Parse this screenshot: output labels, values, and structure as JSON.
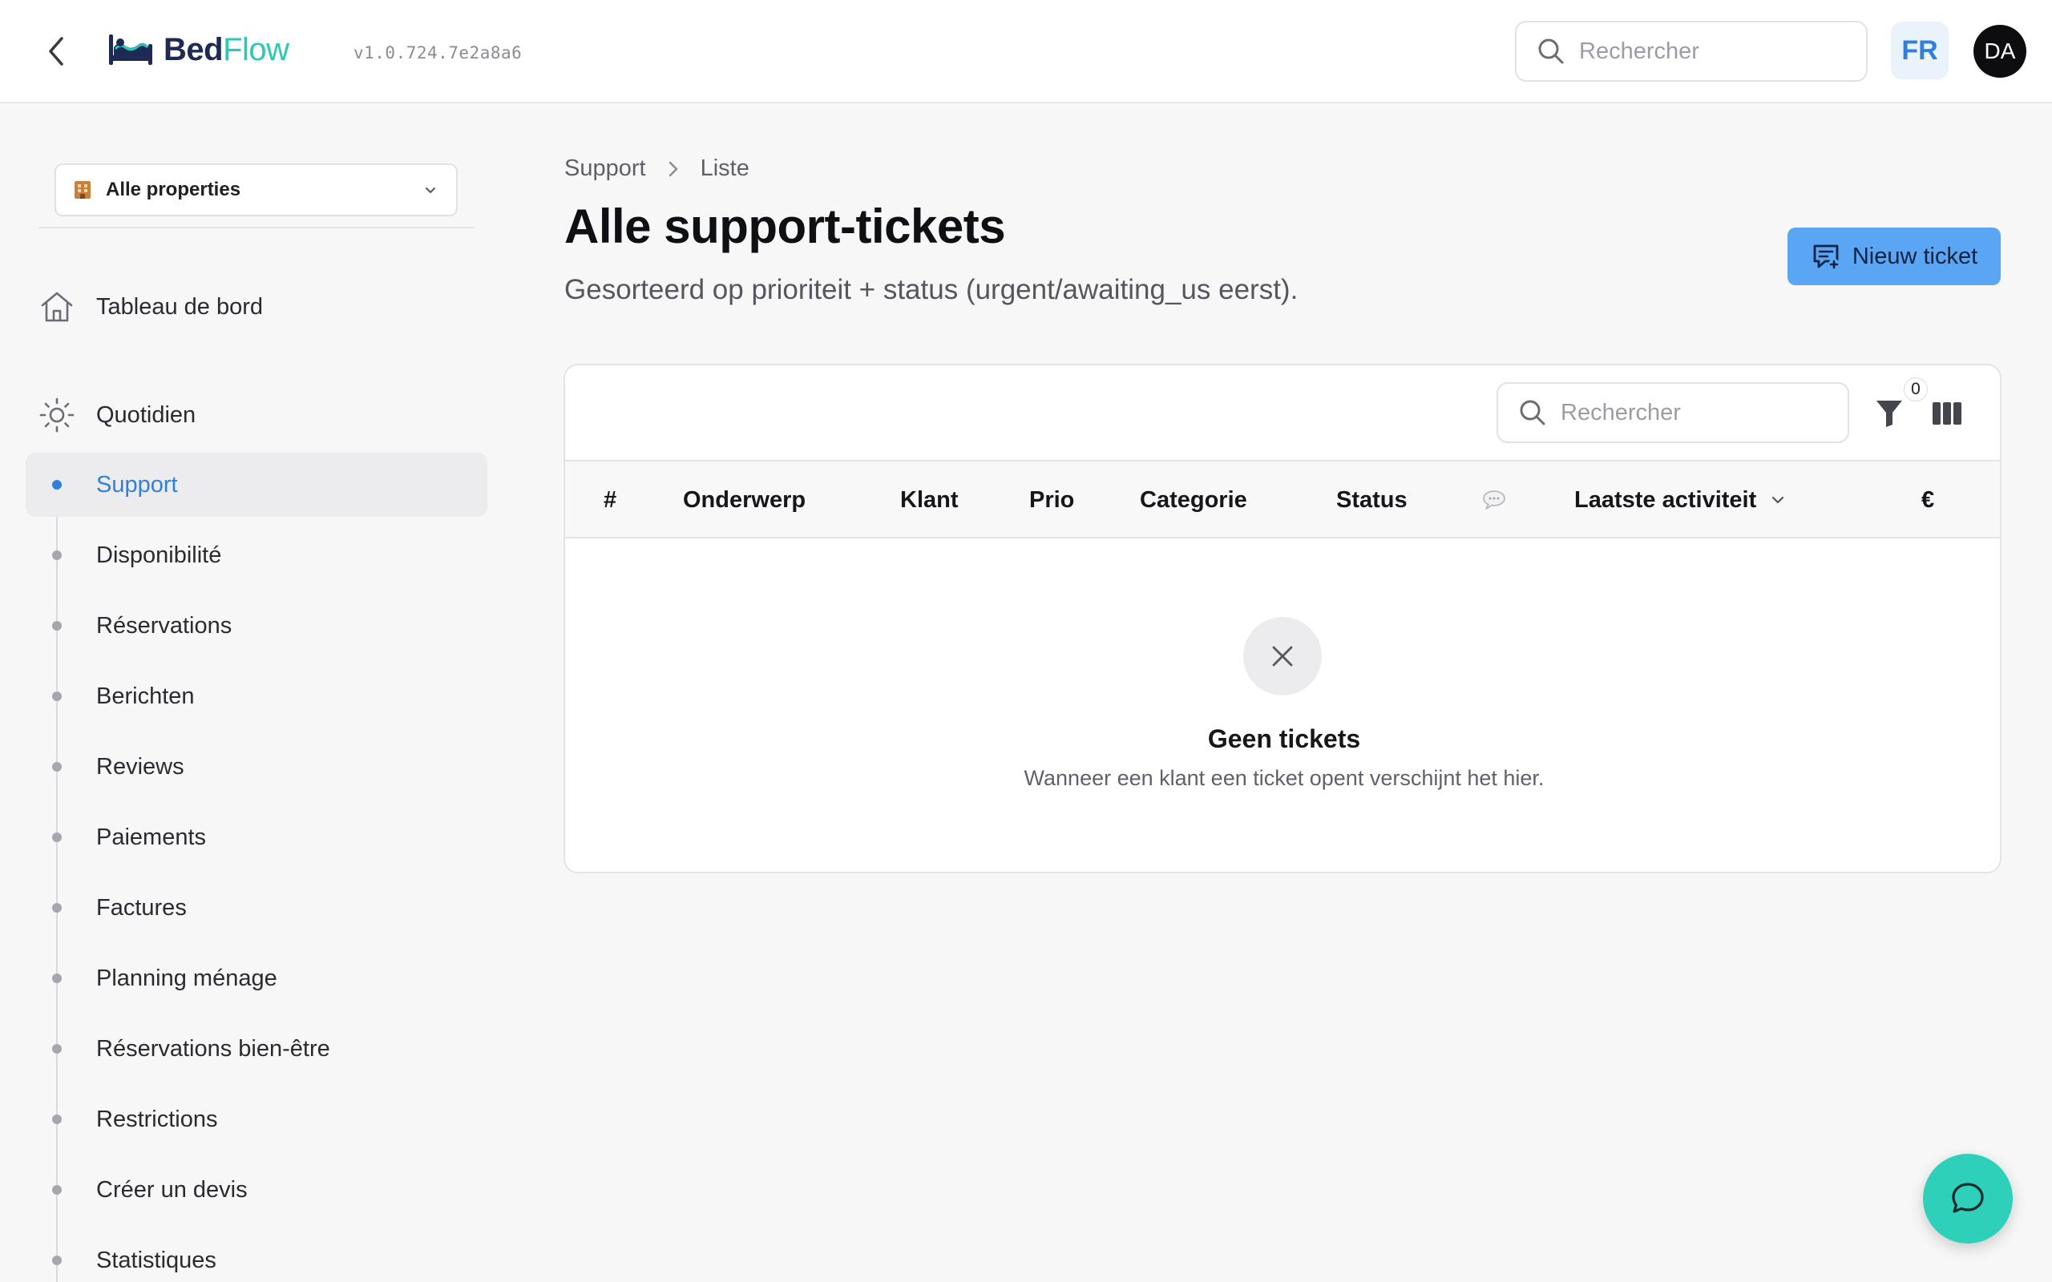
{
  "header": {
    "logo_bed": "Bed",
    "logo_flow": "Flow",
    "version": "v1.0.724.7e2a8a6",
    "search_placeholder": "Rechercher",
    "language": "FR",
    "avatar_initials": "DA",
    "icons": {
      "back": "chevron-left-icon",
      "search": "search-icon",
      "logo": "bed-icon"
    }
  },
  "sidebar": {
    "property_selector": {
      "label": "Alle properties",
      "icon": "building-icon"
    },
    "dashboard": {
      "label": "Tableau de bord",
      "icon": "home-icon"
    },
    "section": {
      "label": "Quotidien",
      "icon": "sun-icon"
    },
    "items": [
      {
        "label": "Support",
        "active": true
      },
      {
        "label": "Disponibilité",
        "active": false
      },
      {
        "label": "Réservations",
        "active": false
      },
      {
        "label": "Berichten",
        "active": false
      },
      {
        "label": "Reviews",
        "active": false
      },
      {
        "label": "Paiements",
        "active": false
      },
      {
        "label": "Factures",
        "active": false
      },
      {
        "label": "Planning ménage",
        "active": false
      },
      {
        "label": "Réservations bien-être",
        "active": false
      },
      {
        "label": "Restrictions",
        "active": false
      },
      {
        "label": "Créer un devis",
        "active": false
      },
      {
        "label": "Statistiques",
        "active": false
      }
    ]
  },
  "main": {
    "breadcrumb": [
      "Support",
      "Liste"
    ],
    "title": "Alle support-tickets",
    "subtitle": "Gesorteerd op prioriteit + status (urgent/awaiting_us eerst).",
    "new_ticket_label": "Nieuw ticket",
    "table": {
      "search_placeholder": "Rechercher",
      "filter_count": "0",
      "columns": [
        "#",
        "Onderwerp",
        "Klant",
        "Prio",
        "Categorie",
        "Status",
        "",
        "Laatste activiteit",
        "€"
      ],
      "sorted_column": "Laatste activiteit",
      "rows": [],
      "empty_title": "Geen tickets",
      "empty_text": "Wanneer een klant een ticket opent verschijnt het hier."
    }
  },
  "colors": {
    "accent": "#2f7fe0",
    "primary_button": "#5aa6f5",
    "brand_dark": "#1e2a55",
    "brand_teal": "#2cc7b5",
    "chat_fab": "#2fd0b9"
  }
}
